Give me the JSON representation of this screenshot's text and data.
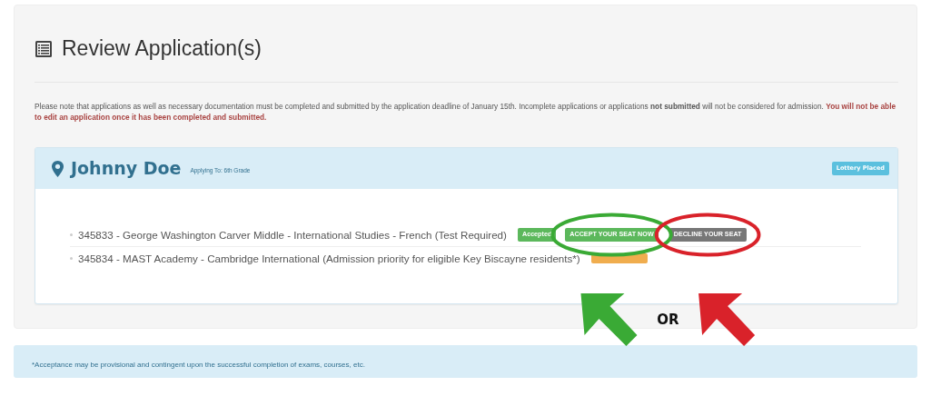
{
  "page": {
    "title": "Review Application(s)",
    "notice": "Please note that applications as well as necessary documentation must be completed and submitted by the application deadline of January 15th. Incomplete applications or applications **not submitted** will not be considered for admission.",
    "warning": "You will not be able to edit an application once it has been completed and submitted."
  },
  "applicant": {
    "name": "Johnny Doe",
    "applying_to": "Applying To: 6th Grade",
    "status": "Lottery Placed",
    "applications": [
      {
        "text": "345833 - George Washington Carver Middle - International Studies - French (Test Required)",
        "badges": [
          {
            "kind": "status",
            "label": "Accepted",
            "color": "#5cb85c"
          },
          {
            "kind": "action",
            "label": "ACCEPT YOUR SEAT NOW",
            "color": "#5cb85c"
          },
          {
            "kind": "action",
            "label": "DECLINE YOUR SEAT",
            "color": "#777777"
          }
        ]
      },
      {
        "text": "345834 - MAST Academy - Cambridge International (Admission priority for eligible Key Biscayne residents*)",
        "badges": [
          {
            "kind": "status",
            "color": "#f0ad4e"
          }
        ]
      }
    ]
  },
  "annotations": [
    {
      "kind": "ellipse",
      "color": "#3aaa35"
    },
    {
      "kind": "ellipse",
      "color": "#d9222a"
    },
    {
      "kind": "arrow",
      "color": "#3aaa35"
    },
    {
      "kind": "text",
      "label": "OR"
    },
    {
      "kind": "arrow",
      "color": "#d9222a"
    }
  ],
  "footnote": "*Acceptance may be provisional and contingent upon the successful completion of exams, courses, etc."
}
